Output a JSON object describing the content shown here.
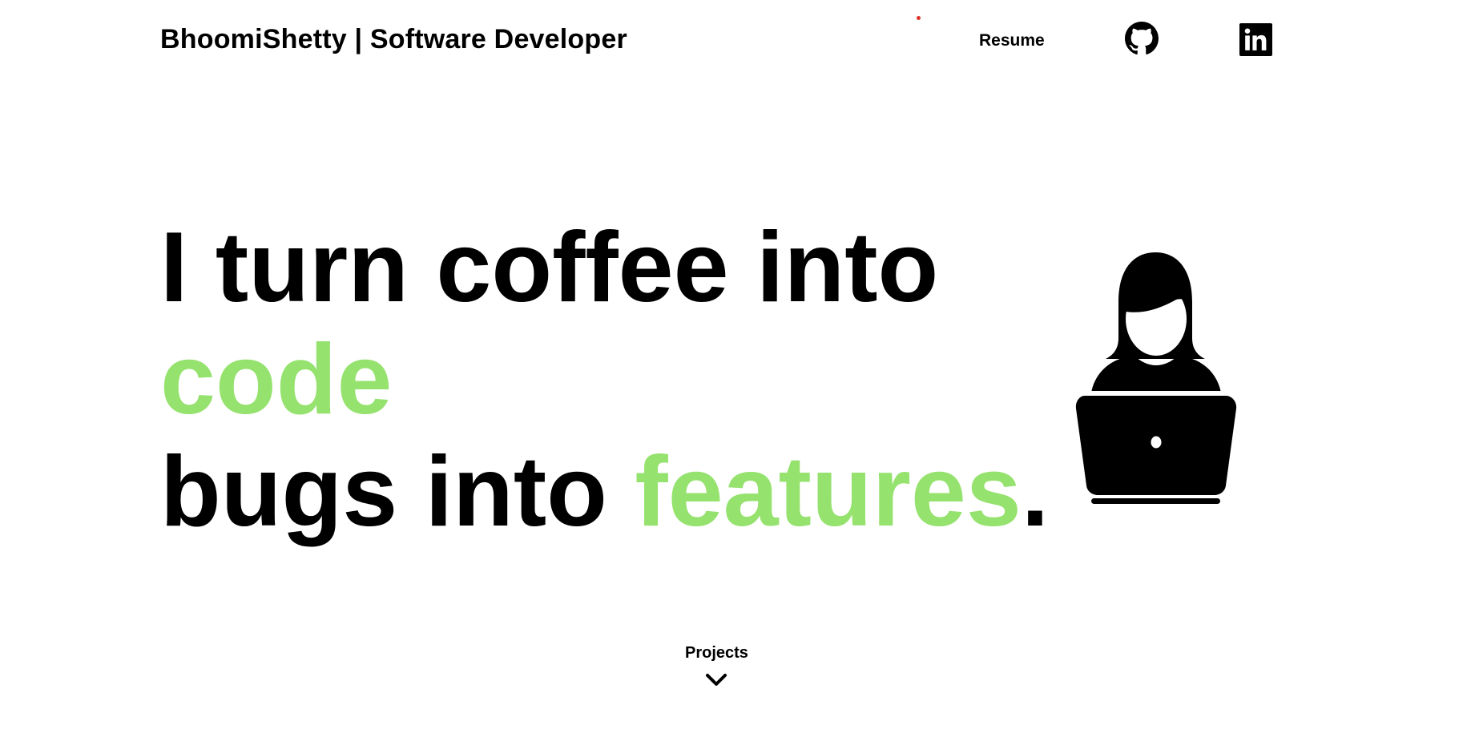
{
  "header": {
    "brand": "BhoomiShetty | Software Developer",
    "nav": {
      "resume_label": "Resume",
      "github_icon": "github-icon",
      "linkedin_icon": "linkedin-icon"
    },
    "status_dot_color": "#e0312b"
  },
  "hero": {
    "line1": "I turn coffee into",
    "line2_accent": "code",
    "line3_prefix": "bugs into ",
    "line3_accent": "features",
    "line3_suffix": ".",
    "accent_color": "#95e26e",
    "illustration_icon": "developer-at-laptop-icon"
  },
  "footer": {
    "projects_label": "Projects",
    "scroll_icon": "chevron-down-icon"
  }
}
